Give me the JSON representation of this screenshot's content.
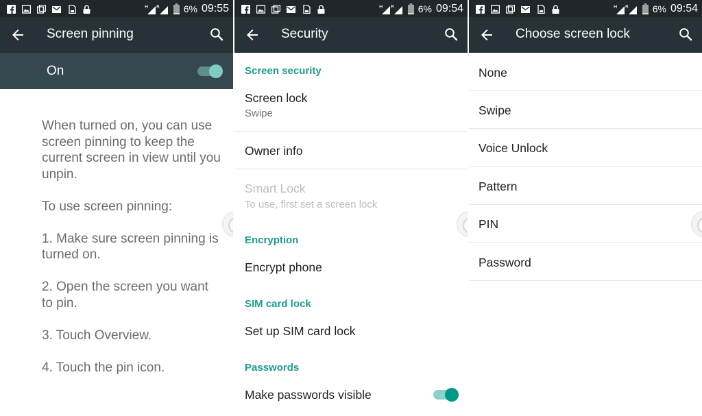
{
  "screens": [
    {
      "status": {
        "battery": "6%",
        "time": "09:55"
      },
      "toolbar": {
        "title": "Screen pinning"
      },
      "switch": {
        "label": "On",
        "checked": true
      },
      "description": [
        "When turned on, you can use screen pinning to keep the current screen in view until you unpin.",
        "To use screen pinning:",
        "1. Make sure screen pinning is turned on.",
        "2. Open the screen you want to pin.",
        "3. Touch Overview.",
        "4. Touch the pin icon."
      ]
    },
    {
      "status": {
        "battery": "6%",
        "time": "09:54"
      },
      "toolbar": {
        "title": "Security"
      },
      "sections": {
        "screen_security": "Screen security",
        "encryption": "Encryption",
        "sim_card_lock": "SIM card lock",
        "passwords": "Passwords"
      },
      "items": {
        "screen_lock": {
          "title": "Screen lock",
          "summary": "Swipe"
        },
        "owner_info": {
          "title": "Owner info"
        },
        "smart_lock": {
          "title": "Smart Lock",
          "summary": "To use, first set a screen lock"
        },
        "encrypt_phone": {
          "title": "Encrypt phone"
        },
        "sim_lock": {
          "title": "Set up SIM card lock"
        },
        "passwords_visible": {
          "title": "Make passwords visible",
          "checked": true
        }
      }
    },
    {
      "status": {
        "battery": "6%",
        "time": "09:54"
      },
      "toolbar": {
        "title": "Choose screen lock"
      },
      "options": [
        "None",
        "Swipe",
        "Voice Unlock",
        "Pattern",
        "PIN",
        "Password"
      ]
    }
  ],
  "colors": {
    "status_bar": "#1f272a",
    "toolbar": "#263238",
    "switch_bar": "#37474f",
    "accent": "#009688",
    "section_header": "#1e9c8c"
  },
  "icons": {
    "back": "arrow-back-icon",
    "search": "search-icon",
    "status": [
      "facebook-icon",
      "image-icon",
      "gallery-icon",
      "gmail-icon",
      "sd-card-icon",
      "lock-icon",
      "signal-h-icon",
      "signal-r-icon",
      "battery-icon"
    ]
  }
}
